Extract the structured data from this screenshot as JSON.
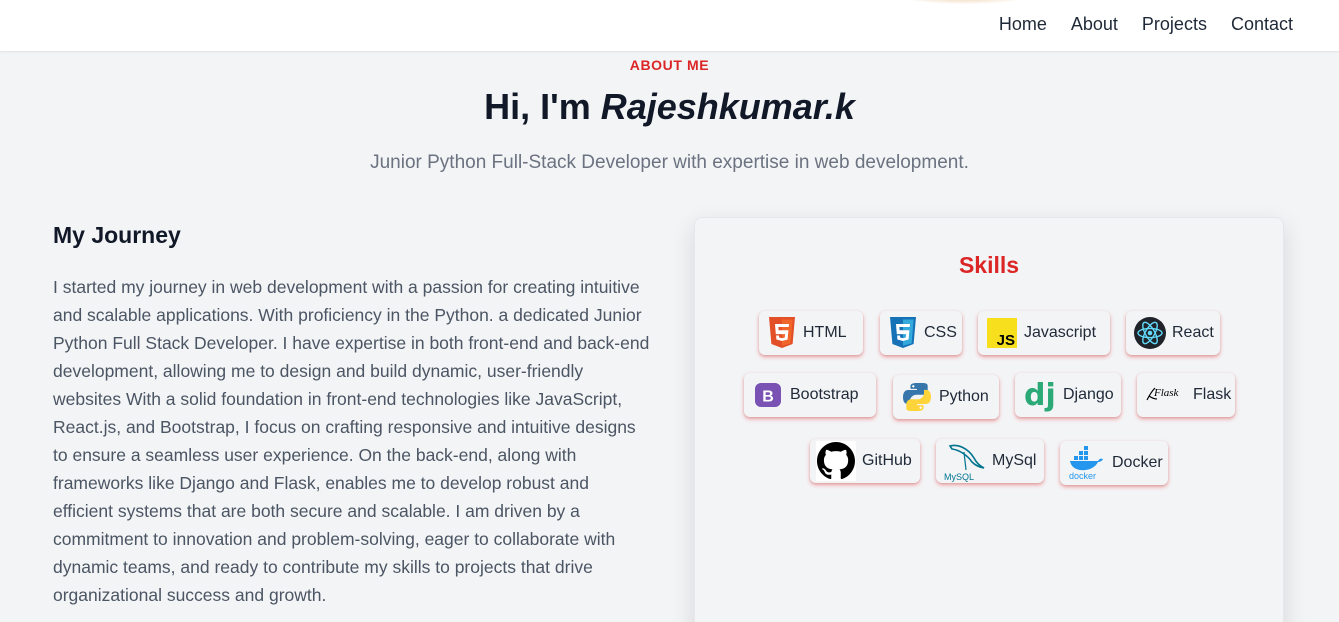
{
  "nav": {
    "links": [
      "Home",
      "About",
      "Projects",
      "Contact"
    ]
  },
  "header": {
    "eyebrow": "ABOUT ME",
    "title_prefix": "Hi, I'm ",
    "title_name": "Rajeshkumar.k",
    "subtitle": "Junior Python Full-Stack Developer with expertise in web development."
  },
  "journey": {
    "title": "My Journey",
    "text": "I started my journey in web development with a passion for creating intuitive and scalable applications. With proficiency in the Python. a dedicated Junior Python Full Stack Developer. I have expertise in both front-end and back-end development, allowing me to design and build dynamic, user-friendly websites With a solid foundation in front-end technologies like JavaScript, React.js, and Bootstrap, I focus on crafting responsive and intuitive designs to ensure a seamless user experience. On the back-end, along with frameworks like Django and Flask, enables me to develop robust and efficient systems that are both secure and scalable. I am driven by a commitment to innovation and problem-solving, eager to collaborate with dynamic teams, and ready to contribute my skills to projects that drive organizational success and growth."
  },
  "skills": {
    "title": "Skills",
    "items": [
      {
        "label": "HTML",
        "icon": "html5-icon",
        "color": "#e34f26"
      },
      {
        "label": "CSS",
        "icon": "css3-icon",
        "color": "#1572b6"
      },
      {
        "label": "Javascript",
        "icon": "javascript-icon",
        "color": "#f7df1e"
      },
      {
        "label": "React",
        "icon": "react-icon",
        "color": "#61dafb"
      },
      {
        "label": "Bootstrap",
        "icon": "bootstrap-icon",
        "color": "#7952b3"
      },
      {
        "label": "Python",
        "icon": "python-icon",
        "color": "#3776ab"
      },
      {
        "label": "Django",
        "icon": "django-icon",
        "color": "#2ba977"
      },
      {
        "label": "Flask",
        "icon": "flask-icon",
        "color": "#000000"
      },
      {
        "label": "GitHub",
        "icon": "github-icon",
        "color": "#000000"
      },
      {
        "label": "MySql",
        "icon": "mysql-icon",
        "color": "#00758f"
      },
      {
        "label": "Docker",
        "icon": "docker-icon",
        "color": "#2496ed"
      }
    ],
    "icon_texts": {
      "javascript": "JS",
      "bootstrap": "B",
      "django": "dj",
      "flask": "Flask",
      "mysql": "MySQL",
      "docker": "docker"
    }
  },
  "colors": {
    "accent": "#dc2626",
    "background": "#f3f4f6"
  }
}
